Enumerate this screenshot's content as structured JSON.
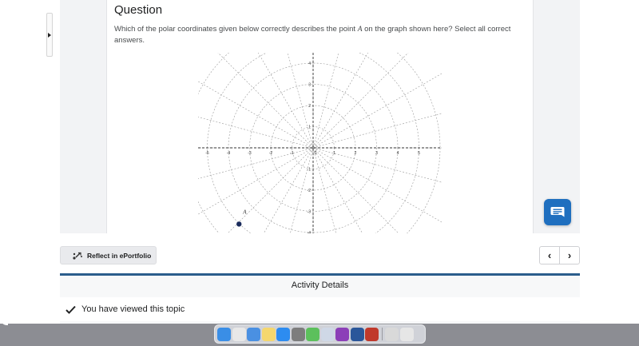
{
  "question": {
    "title": "Question",
    "text_before": "Which of the polar coordinates given below correctly describes the point ",
    "point_var": "A",
    "text_after": " on the graph shown here? Select all correct answers."
  },
  "graph": {
    "x_ticks": [
      "-5",
      "-4",
      "-3",
      "-2",
      "-1",
      "0",
      "1",
      "2",
      "3",
      "4",
      "5"
    ],
    "y_ticks": [
      "4",
      "3",
      "2",
      "1",
      "0",
      "-1",
      "-2",
      "-3",
      "-4"
    ],
    "point_label": "A",
    "point": {
      "x": -3.5,
      "y": -3.6
    },
    "ring_radii": [
      1,
      2,
      3,
      4,
      5,
      6
    ],
    "ray_step_degrees": 15,
    "point_color": "#1a2b5c",
    "grid_color": "#9a9a9a"
  },
  "toolbar": {
    "reflect_label": "Reflect in ePortfolio",
    "prev_icon": "‹",
    "next_icon": "›"
  },
  "activity": {
    "title": "Activity Details",
    "viewed_text": "You have viewed this topic"
  },
  "colors": {
    "accent": "#1f6fbf",
    "activity_border": "#2b5d8c"
  },
  "dock": {
    "icons": [
      {
        "name": "finder-icon",
        "color": "#3a8ee6"
      },
      {
        "name": "chrome-icon",
        "color": "#e8e8e8"
      },
      {
        "name": "mail-icon",
        "color": "#4a90e2"
      },
      {
        "name": "notes-icon",
        "color": "#f5d76e"
      },
      {
        "name": "app-store-icon",
        "color": "#2d8cf0"
      },
      {
        "name": "system-preferences-icon",
        "color": "#7d7d7d"
      },
      {
        "name": "messages-icon",
        "color": "#5cc05c"
      },
      {
        "name": "preview-icon",
        "color": "#cfd8e6"
      },
      {
        "name": "onenote-icon",
        "color": "#8c3fb8"
      },
      {
        "name": "word-icon",
        "color": "#2b579a"
      },
      {
        "name": "dictionary-icon",
        "color": "#c0392b"
      },
      {
        "name": "documents-icon",
        "color": "#d9d9d9"
      },
      {
        "name": "trash-icon",
        "color": "#e6e6e6"
      }
    ]
  }
}
